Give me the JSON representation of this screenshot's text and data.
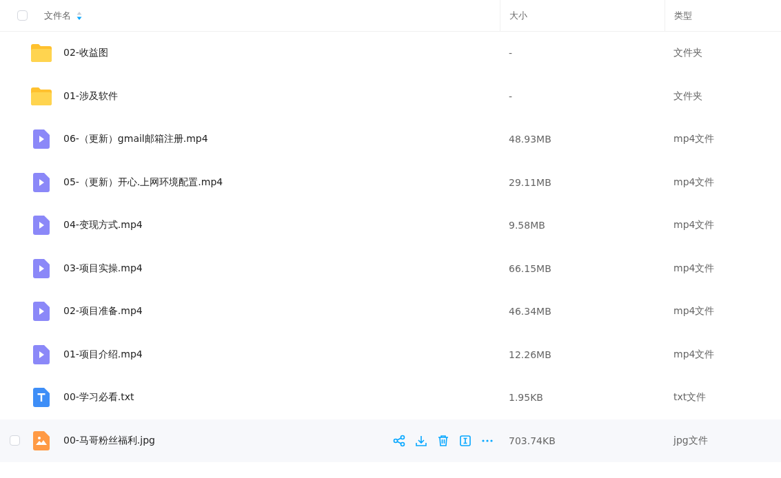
{
  "header": {
    "checked": false,
    "columns": [
      "文件名",
      "大小",
      "类型"
    ]
  },
  "rows": [
    {
      "kind": "folder",
      "name": "02-收益图",
      "size": "-",
      "type": "文件夹",
      "hovered": false
    },
    {
      "kind": "folder",
      "name": "01-涉及软件",
      "size": "-",
      "type": "文件夹",
      "hovered": false
    },
    {
      "kind": "video",
      "name": "06-（更新）gmail邮箱注册.mp4",
      "size": "48.93MB",
      "type": "mp4文件",
      "hovered": false
    },
    {
      "kind": "video",
      "name": "05-（更新）开心.上网环境配置.mp4",
      "size": "29.11MB",
      "type": "mp4文件",
      "hovered": false
    },
    {
      "kind": "video",
      "name": "04-变现方式.mp4",
      "size": "9.58MB",
      "type": "mp4文件",
      "hovered": false
    },
    {
      "kind": "video",
      "name": "03-项目实操.mp4",
      "size": "66.15MB",
      "type": "mp4文件",
      "hovered": false
    },
    {
      "kind": "video",
      "name": "02-项目准备.mp4",
      "size": "46.34MB",
      "type": "mp4文件",
      "hovered": false
    },
    {
      "kind": "video",
      "name": "01-项目介绍.mp4",
      "size": "12.26MB",
      "type": "mp4文件",
      "hovered": false
    },
    {
      "kind": "text",
      "name": "00-学习必看.txt",
      "size": "1.95KB",
      "type": "txt文件",
      "hovered": false
    },
    {
      "kind": "image",
      "name": "00-马哥粉丝福利.jpg",
      "size": "703.74KB",
      "type": "jpg文件",
      "hovered": true
    }
  ]
}
